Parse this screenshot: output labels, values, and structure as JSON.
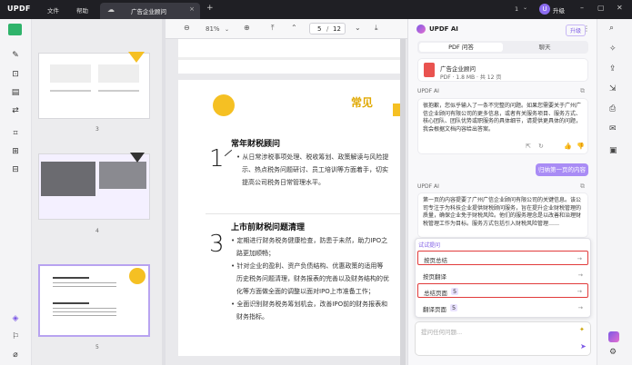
{
  "titlebar": {
    "logo": "UPDF",
    "menu_file": "文件",
    "menu_help": "帮助",
    "tab_title": "广告企业顾问",
    "tab_close": "×",
    "new_tab": "+",
    "account_count": "1",
    "avatar_letter": "U",
    "upgrade": "升级"
  },
  "thumbnails": {
    "page_numbers": [
      "3",
      "4",
      "5"
    ]
  },
  "toolbar": {
    "zoom": "81%",
    "page_current": "5",
    "page_sep": "/",
    "page_total": "12"
  },
  "doc": {
    "big_number_top": "1",
    "heading1": "常年财税顾问",
    "para1_lines": [
      "从日常涉税事项处理、税收筹划、政策解读与风险提",
      "示、热点税务问题研讨、员工培训等方面着手，切实",
      "提高公司税务日常管理水平。"
    ],
    "heading2": "上市前财税问题清理",
    "big_number_mid": "3",
    "list_lines": [
      "定期进行财务税务健康检查，防患于未然，助力IPO之",
      "路更加顺畅；",
      "针对企业的盈利、资产负债结构、优惠政策的适用等",
      "历史税务问题清理，财务报表的完善以及财务结构的优",
      "化等方面做全面的调整以面对IPO上市准备工作；",
      "全面识别财务税务筹划机会，改善IPO前的财务报表和",
      "财务指标。"
    ],
    "right_badge": "常见"
  },
  "ai": {
    "title": "UPDF AI",
    "pro_badge": "升级",
    "tab_pdf": "PDF 问答",
    "tab_chat": "聊天",
    "file_name": "广告企业顾问",
    "file_meta": "PDF · 1.8 MB · 共 12 页",
    "label1": "UPDF AI",
    "msg1": "很抱歉，您似乎输入了一条不完整的问题。如果您需要关于广州广信企业顾问有限公司的更多信息，或者有关服务项目、服务方式、核心团队、团队优势或职服务的具体细节，请提供更具体的问题，我会根据文档内容给出答案。",
    "summary_btn": "归纳第一页的内容",
    "label2": "UPDF AI",
    "msg2": "第一页的内容提要了广州广信企业顾问有限公司的关键信息。该公司专注于为科技企业提供财税顾问服务，旨在提升企业财税管理的质量，确保企业免于财税风险。他们的服务理念是以改善和治理财税管理工作为目标。服务方式包括引入财税风险管理……",
    "suggest_header": "试试提问",
    "menu_items": [
      {
        "label": "按页总结",
        "badge": "",
        "arrow": "→"
      },
      {
        "label": "按页翻译",
        "badge": "",
        "arrow": "→"
      },
      {
        "label": "总结页面",
        "badge": "5",
        "arrow": "→"
      },
      {
        "label": "翻译页面",
        "badge": "5",
        "arrow": "→"
      }
    ],
    "input_placeholder": "提问任何问题..."
  },
  "colors": {
    "accent": "#7b58e5",
    "accent_light": "#a98cf5",
    "redbox": "#e13b3b",
    "titlebar_bg": "#1f1f24",
    "doc_yellow": "#f5c023"
  }
}
